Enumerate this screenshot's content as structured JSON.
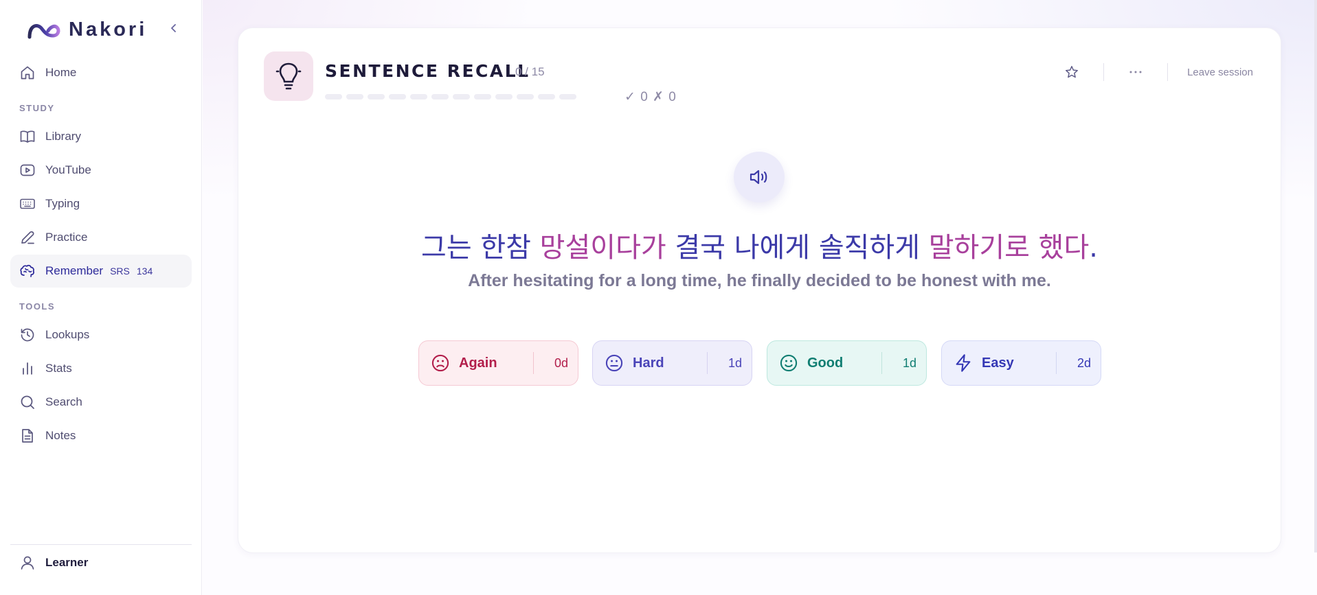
{
  "brand": {
    "name": "Nakori"
  },
  "sidebar": {
    "home": "Home",
    "study_label": "STUDY",
    "study_items": [
      "Library",
      "YouTube",
      "Typing",
      "Practice"
    ],
    "remember": {
      "label": "Remember",
      "srs": "SRS",
      "count": "134"
    },
    "tools_label": "TOOLS",
    "tool_items": [
      "Lookups",
      "Stats",
      "Search",
      "Notes"
    ],
    "user": "Learner"
  },
  "session": {
    "title": "SENTENCE RECALL",
    "count": "0 / 15",
    "progress_segments_total": 12,
    "progress_segments_done": 0,
    "score": "✓ 0 ✗ 0",
    "leave_label": "Leave session"
  },
  "card": {
    "sentence_parts": [
      "그는 한참 ",
      "망설이다가",
      " 결국 나에게 솔직하게 ",
      "말하기로 했다",
      "."
    ],
    "translation": "After hesitating for a long time, he finally decided to be honest with me."
  },
  "ratings": {
    "again": {
      "label": "Again",
      "interval": "0d"
    },
    "hard": {
      "label": "Hard",
      "interval": "1d"
    },
    "good": {
      "label": "Good",
      "interval": "1d"
    },
    "easy": {
      "label": "Easy",
      "interval": "2d"
    }
  },
  "colors": {
    "accent": "#3c3aa8",
    "highlight": "#a8409c",
    "again": "#b21e4b",
    "hard": "#4a44b8",
    "good": "#107e72",
    "easy": "#3538b5"
  }
}
